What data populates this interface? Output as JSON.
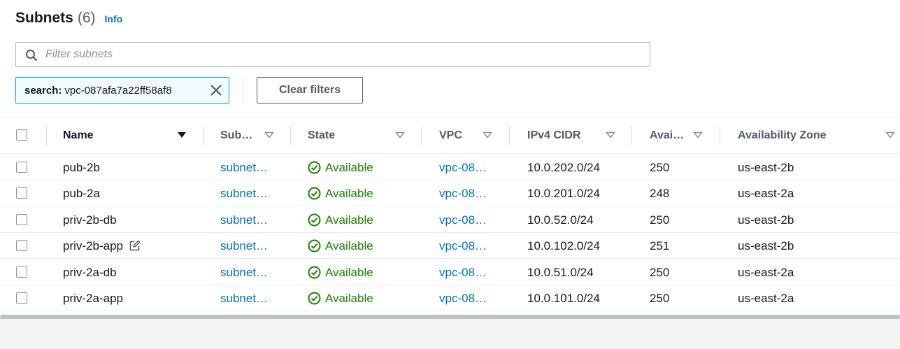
{
  "header": {
    "title": "Subnets",
    "count": "(6)",
    "info": "Info"
  },
  "filter": {
    "placeholder": "Filter subnets",
    "value": ""
  },
  "token": {
    "key": "search:",
    "value": "vpc-087afa7a22ff58af8"
  },
  "clear_filters": "Clear filters",
  "columns": {
    "name": "Name",
    "subnet_id": "Sub…",
    "state": "State",
    "vpc": "VPC",
    "cidr": "IPv4 CIDR",
    "avail_ips": "Avai…",
    "az": "Availability Zone"
  },
  "rows": [
    {
      "name": "pub-2b",
      "subnet_id": "subnet…",
      "state": "Available",
      "vpc": "vpc-08…",
      "cidr": "10.0.202.0/24",
      "ips": "250",
      "az": "us-east-2b"
    },
    {
      "name": "pub-2a",
      "subnet_id": "subnet…",
      "state": "Available",
      "vpc": "vpc-08…",
      "cidr": "10.0.201.0/24",
      "ips": "248",
      "az": "us-east-2a"
    },
    {
      "name": "priv-2b-db",
      "subnet_id": "subnet…",
      "state": "Available",
      "vpc": "vpc-08…",
      "cidr": "10.0.52.0/24",
      "ips": "250",
      "az": "us-east-2b"
    },
    {
      "name": "priv-2b-app",
      "subnet_id": "subnet…",
      "state": "Available",
      "vpc": "vpc-08…",
      "cidr": "10.0.102.0/24",
      "ips": "251",
      "az": "us-east-2b"
    },
    {
      "name": "priv-2a-db",
      "subnet_id": "subnet…",
      "state": "Available",
      "vpc": "vpc-08…",
      "cidr": "10.0.51.0/24",
      "ips": "250",
      "az": "us-east-2a"
    },
    {
      "name": "priv-2a-app",
      "subnet_id": "subnet…",
      "state": "Available",
      "vpc": "vpc-08…",
      "cidr": "10.0.101.0/24",
      "ips": "250",
      "az": "us-east-2a"
    }
  ],
  "colors": {
    "link": "#0073bb",
    "available": "#1d8102",
    "token_border": "#00a1c9"
  },
  "icons": {
    "search": "search-icon",
    "dismiss": "close-icon",
    "edit": "edit-icon",
    "sort": "caret-down-icon",
    "status": "check-circle-icon"
  }
}
